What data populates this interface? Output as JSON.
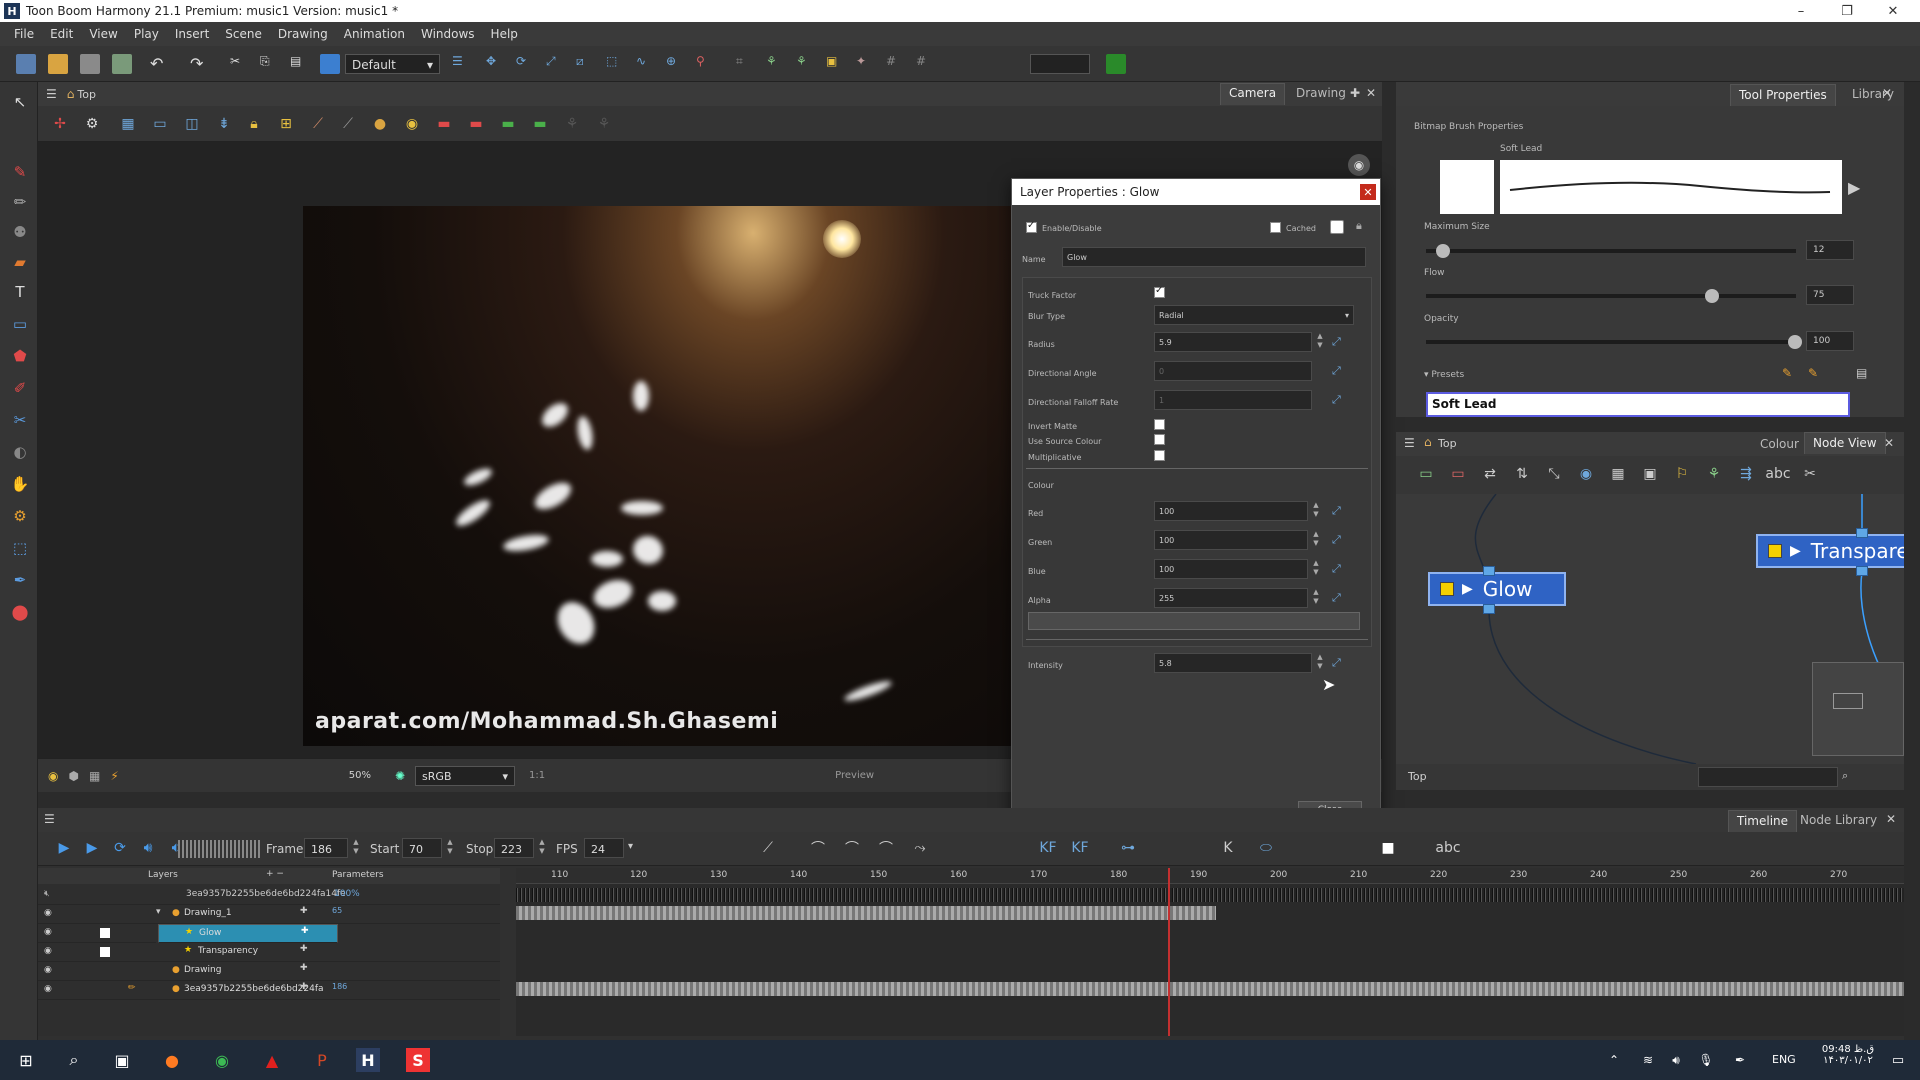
{
  "window": {
    "title": "Toon Boom Harmony 21.1 Premium: music1 Version: music1 *"
  },
  "menu": [
    "File",
    "Edit",
    "View",
    "Play",
    "Insert",
    "Scene",
    "Drawing",
    "Animation",
    "Windows",
    "Help"
  ],
  "toolbar": {
    "workspace": "Default"
  },
  "view": {
    "title": "Top",
    "tabs": [
      "Camera",
      "Drawing"
    ],
    "zoom": "50%",
    "colorspace": "sRGB",
    "ratio": "1:1",
    "mode": "Preview",
    "watermark": "aparat.com/Mohammad.Sh.Ghasemi"
  },
  "dialog": {
    "title": "Layer Properties : Glow",
    "enable_label": "Enable/Disable",
    "cached_label": "Cached",
    "name_label": "Name",
    "name_value": "Glow",
    "truck_factor_label": "Truck Factor",
    "blur_type_label": "Blur Type",
    "blur_type_value": "Radial",
    "radius_label": "Radius",
    "radius_value": "5.9",
    "dir_angle_label": "Directional Angle",
    "dir_angle_value": "0",
    "dir_falloff_label": "Directional Falloff Rate",
    "dir_falloff_value": "1",
    "invert_matte_label": "Invert Matte",
    "use_source_label": "Use Source Colour",
    "multiplicative_label": "Multiplicative",
    "colour_label": "Colour",
    "red_label": "Red",
    "red_value": "100",
    "green_label": "Green",
    "green_value": "100",
    "blue_label": "Blue",
    "blue_value": "100",
    "alpha_label": "Alpha",
    "alpha_value": "255",
    "intensity_label": "Intensity",
    "intensity_value": "5.8",
    "close_label": "Close"
  },
  "tool_properties": {
    "tabs": [
      "Tool Properties",
      "Library"
    ],
    "section": "Bitmap Brush Properties",
    "brush_name": "Soft Lead",
    "max_size_label": "Maximum Size",
    "max_size_value": "12",
    "flow_label": "Flow",
    "flow_value": "75",
    "opacity_label": "Opacity",
    "opacity_value": "100",
    "presets_label": "Presets",
    "preset_selected": "Soft Lead"
  },
  "node_view": {
    "title": "Top",
    "tabs": [
      "Colour",
      "Node View"
    ],
    "nodes": [
      "Glow",
      "Transpare"
    ],
    "footer": "Top"
  },
  "timeline": {
    "tabs": [
      "Timeline",
      "Node Library"
    ],
    "frame_label": "Frame",
    "frame_value": "186",
    "start_label": "Start",
    "start_value": "70",
    "stop_label": "Stop",
    "stop_value": "223",
    "fps_label": "FPS",
    "fps_value": "24",
    "layers_header": "Layers",
    "params_header": "Parameters",
    "layers": [
      {
        "name": "3ea9357b2255be6de6bd224fa14fe",
        "param": "100%"
      },
      {
        "name": "Drawing_1",
        "param": "65"
      },
      {
        "name": "Glow",
        "param": ""
      },
      {
        "name": "Transparency",
        "param": ""
      },
      {
        "name": "Drawing",
        "param": ""
      },
      {
        "name": "3ea9357b2255be6de6bd224fa",
        "param": "186"
      }
    ],
    "ruler": [
      "110",
      "120",
      "130",
      "140",
      "150",
      "160",
      "170",
      "180",
      "190",
      "200",
      "210",
      "220",
      "230",
      "240",
      "250",
      "260",
      "270"
    ]
  },
  "taskbar": {
    "lang": "ENG",
    "time": "09:48 ق.ظ",
    "date": "۱۴۰۳/۰۱/۰۲"
  }
}
